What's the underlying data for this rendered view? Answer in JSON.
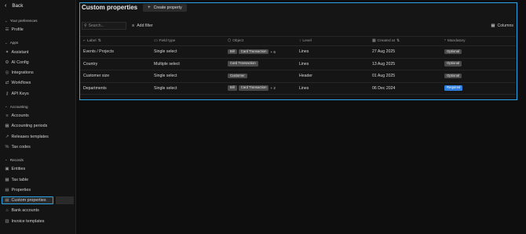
{
  "sidebar": {
    "back_label": "Back",
    "sections": [
      {
        "header": "Your preferences",
        "items": [
          {
            "label": "Profile",
            "icon": "user-icon"
          }
        ]
      },
      {
        "header": "Apps",
        "items": [
          {
            "label": "Assistant",
            "icon": "assistant-icon"
          },
          {
            "label": "AI Config",
            "icon": "ai-config-icon"
          },
          {
            "label": "Integrations",
            "icon": "integrations-icon"
          },
          {
            "label": "Workflows",
            "icon": "workflows-icon"
          },
          {
            "label": "API Keys",
            "icon": "key-icon"
          }
        ]
      },
      {
        "header": "Accounting",
        "items": [
          {
            "label": "Accounts",
            "icon": "accounts-icon"
          },
          {
            "label": "Accounting periods",
            "icon": "calendar-icon"
          },
          {
            "label": "Releases templates",
            "icon": "releases-icon"
          },
          {
            "label": "Tax codes",
            "icon": "percent-icon"
          }
        ]
      },
      {
        "header": "Records",
        "items": [
          {
            "label": "Entities",
            "icon": "entities-icon"
          },
          {
            "label": "Tax table",
            "icon": "table-icon"
          },
          {
            "label": "Properties",
            "icon": "properties-icon"
          },
          {
            "label": "Custom properties",
            "icon": "custom-properties-icon",
            "active": true
          },
          {
            "label": "Bank accounts",
            "icon": "bank-icon"
          },
          {
            "label": "Invoice templates",
            "icon": "invoice-icon"
          }
        ]
      }
    ]
  },
  "page": {
    "title": "Custom properties",
    "create_label": "Create property",
    "search_placeholder": "Search...",
    "filter_label": "Add filter",
    "columns_label": "Columns"
  },
  "table": {
    "headers": [
      {
        "label": "Label",
        "sort": "⇅",
        "icon": "label-icon"
      },
      {
        "label": "Field type",
        "icon": "field-type-icon"
      },
      {
        "label": "Object",
        "icon": "object-icon"
      },
      {
        "label": "Level",
        "icon": "level-icon"
      },
      {
        "label": "Created at",
        "sort": "⇅",
        "icon": "calendar-icon"
      },
      {
        "label": "Mandatory",
        "icon": "asterisk-icon"
      }
    ],
    "rows": [
      {
        "label": "Events / Projects",
        "field_type": "Single select",
        "objects": [
          "Bill",
          "Card Transaction"
        ],
        "more": "+ 6",
        "level": "Lines",
        "created_at": "27 Aug 2025",
        "mandatory": "Optional"
      },
      {
        "label": "Country",
        "field_type": "Multiple select",
        "objects": [
          "Card Transaction"
        ],
        "more": "",
        "level": "Lines",
        "created_at": "13 Aug 2025",
        "mandatory": "Optional"
      },
      {
        "label": "Customer size",
        "field_type": "Single select",
        "objects": [
          "Customer"
        ],
        "more": "",
        "level": "Header",
        "created_at": "01 Aug 2025",
        "mandatory": "Optional"
      },
      {
        "label": "Departments",
        "field_type": "Single select",
        "objects": [
          "Bill",
          "Card Transaction"
        ],
        "more": "+ 2",
        "level": "Lines",
        "created_at": "06 Dec 2024",
        "mandatory": "Required"
      }
    ]
  },
  "colors": {
    "accent": "#2aa6e4",
    "optional_bg": "#4a4a4a",
    "required_bg": "#2f7fe0"
  }
}
